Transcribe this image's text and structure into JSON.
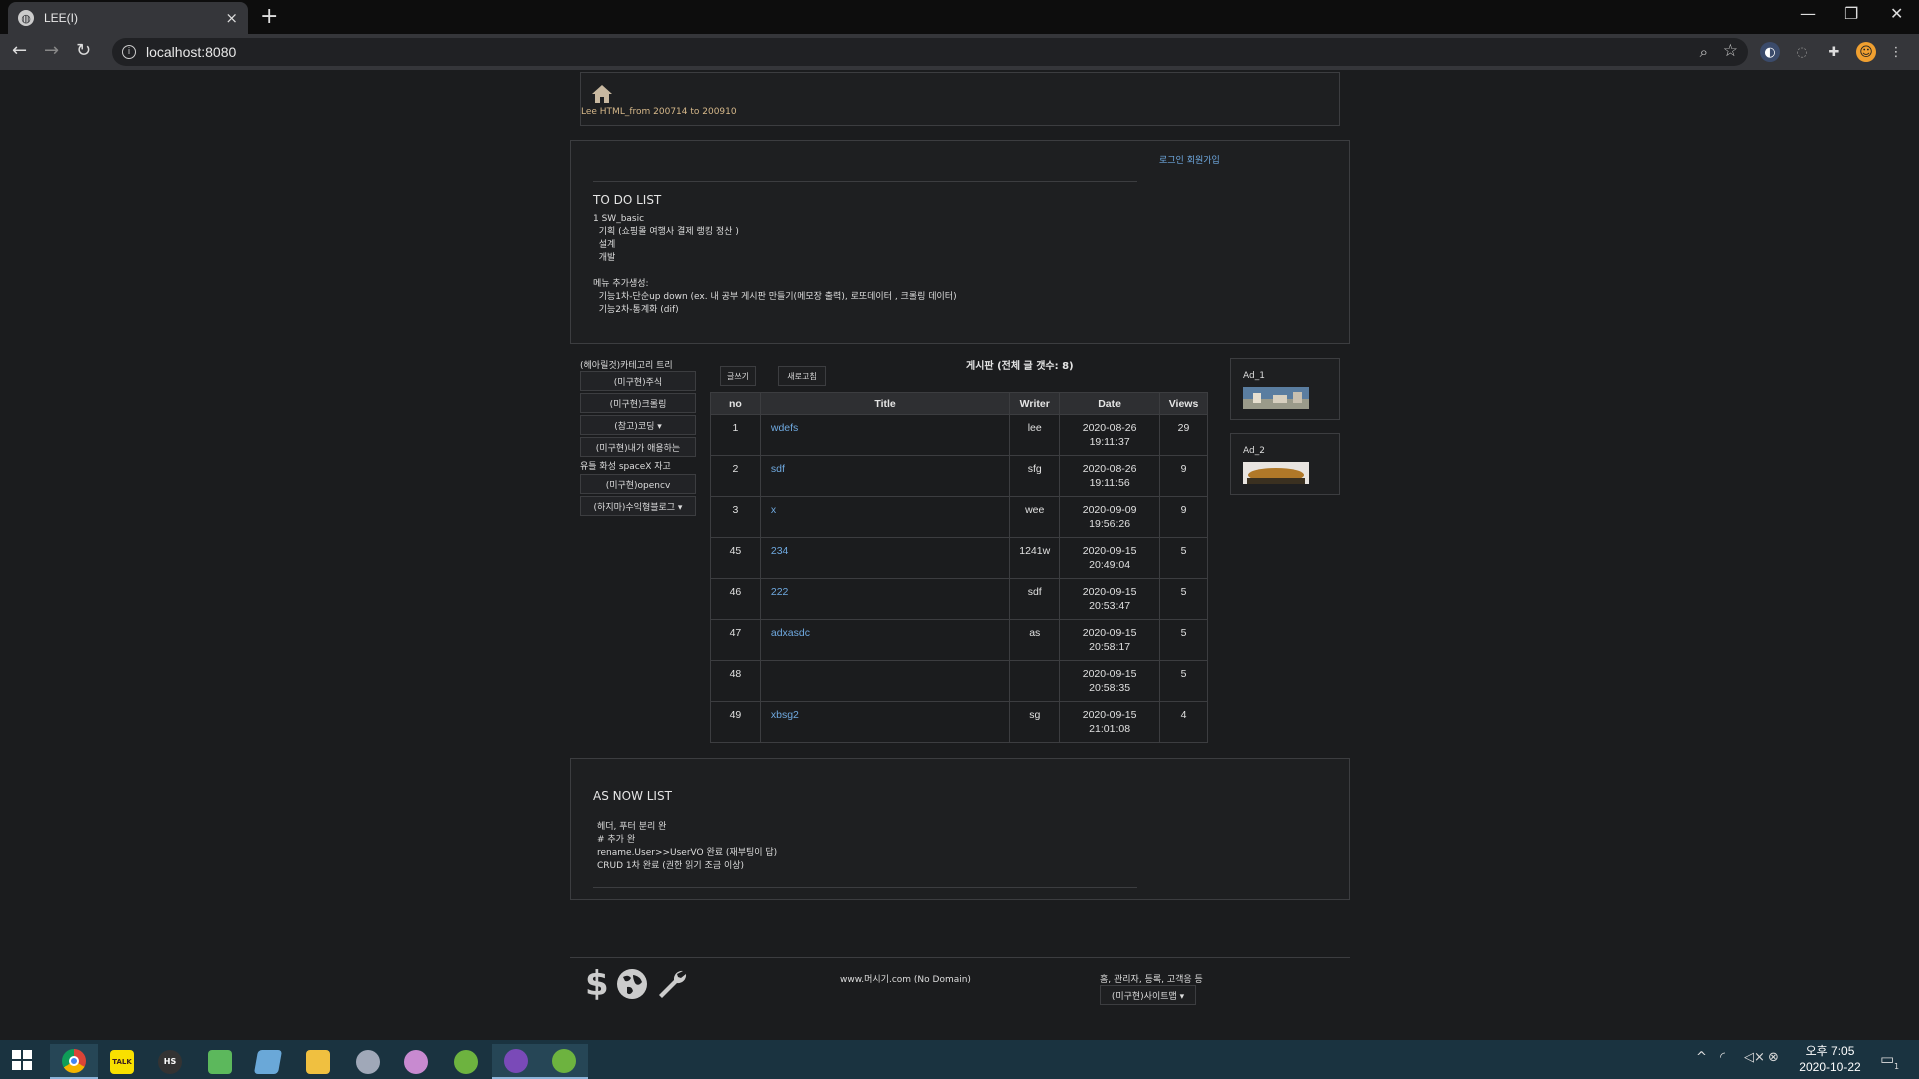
{
  "browser": {
    "tab_title": "LEE(I)",
    "tab_close": "×",
    "new_tab": "+",
    "url": "localhost:8080",
    "window_min": "—",
    "window_restore": "❐",
    "window_close": "✕"
  },
  "header": {
    "text": "Lee HTML_from 200714 to 200910"
  },
  "todo": {
    "login_links": "로그인 회원가입",
    "title": "TO DO LIST",
    "lines": "1 SW_basic\n  기획 (쇼핑몰 여행사 결제 랭킹 정산 )\n  설계\n  개발\n\n메뉴 추가생성:\n  기능1차-단순up down (ex. 내 공부 게시판 만들기(메모장 출력), 로또데이터 , 크롤링 데이터)\n  기능2차-통계화 (dif)"
  },
  "categories": {
    "title": "(헤아릴것)카테고리 트리",
    "items": [
      "(미구현)주식",
      "(미구현)크롤링",
      "(참고)코딩 ▾",
      "(미구현)내가 애용하는",
      "(미구현)opencv",
      "(하지마)수익형블로그 ▾"
    ],
    "free_text": "유틀 화성 spaceX 자고"
  },
  "board": {
    "title": "게시판 (전체 글 갯수:  8)",
    "write_button": "글쓰기",
    "refresh_button": "새로고침",
    "columns": [
      "no",
      "Title",
      "Writer",
      "Date",
      "Views"
    ],
    "rows": [
      {
        "no": "1",
        "title": "wdefs",
        "writer": "lee",
        "date": "2020-08-26",
        "time": "19:11:37",
        "views": "29"
      },
      {
        "no": "2",
        "title": "sdf",
        "writer": "sfg",
        "date": "2020-08-26",
        "time": "19:11:56",
        "views": "9"
      },
      {
        "no": "3",
        "title": "x",
        "writer": "wee",
        "date": "2020-09-09",
        "time": "19:56:26",
        "views": "9"
      },
      {
        "no": "45",
        "title": "234",
        "writer": "1241w",
        "date": "2020-09-15",
        "time": "20:49:04",
        "views": "5"
      },
      {
        "no": "46",
        "title": "222",
        "writer": "sdf",
        "date": "2020-09-15",
        "time": "20:53:47",
        "views": "5"
      },
      {
        "no": "47",
        "title": "adxasdc",
        "writer": "as",
        "date": "2020-09-15",
        "time": "20:58:17",
        "views": "5"
      },
      {
        "no": "48",
        "title": "",
        "writer": "",
        "date": "2020-09-15",
        "time": "20:58:35",
        "views": "5"
      },
      {
        "no": "49",
        "title": "xbsg2",
        "writer": "sg",
        "date": "2020-09-15",
        "time": "21:01:08",
        "views": "4"
      }
    ]
  },
  "ads": [
    {
      "label": "Ad_1"
    },
    {
      "label": "Ad_2"
    }
  ],
  "asnow": {
    "title": "AS NOW LIST",
    "lines": "헤더, 푸터 분리 완\n# 추가 완\nrename.User>>UserVO 완료 (재부팅이 답)\nCRUD 1차 완료 (권한 읽기 조금 이상)"
  },
  "footer": {
    "domain": "www.머시기.com (No Domain)",
    "nav": "홈, 관리자, 등록, 고객응 등",
    "sitemap_button": "(미구현)사이트맵 ▾",
    "icon_dollar": "$"
  },
  "taskbar": {
    "apps": [
      "chrome",
      "talk",
      "hs",
      "notepad",
      "notes",
      "explorer",
      "network",
      "paint",
      "spring1",
      "chat",
      "spring2"
    ],
    "talk_label": "TALK",
    "hs_label": "HS",
    "time": "오후 7:05",
    "date": "2020-10-22",
    "notification_count": "1"
  }
}
